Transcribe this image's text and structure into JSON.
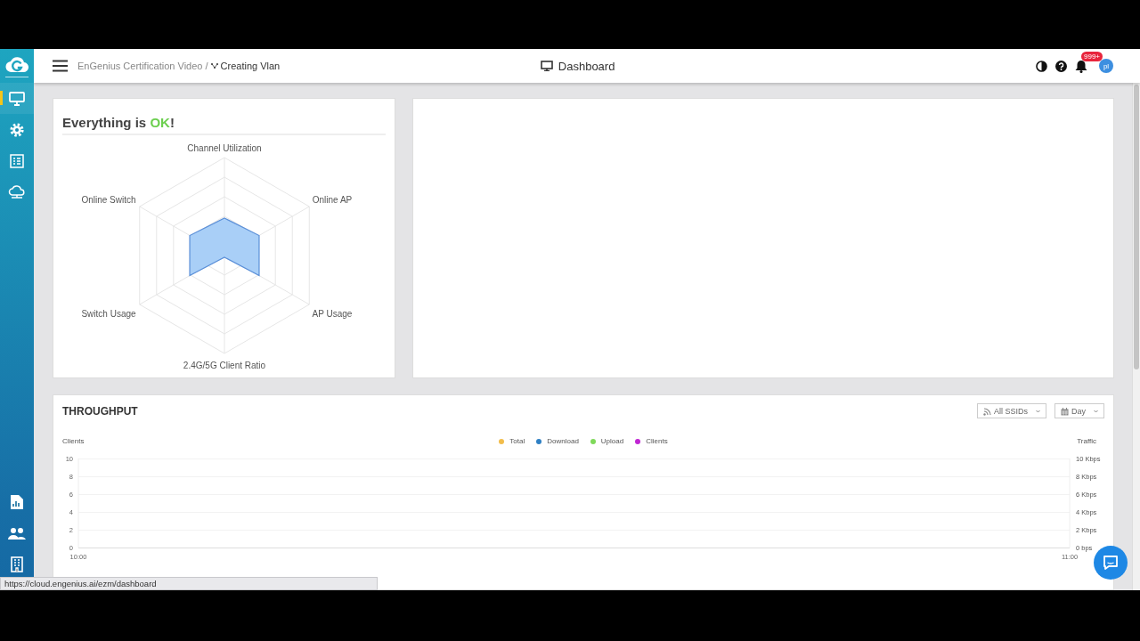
{
  "sidebar": {
    "top_items": [
      {
        "selected": true
      },
      {
        "selected": false
      },
      {
        "selected": false
      },
      {
        "selected": false
      }
    ],
    "bottom_items": [
      {
        "selected": false
      },
      {
        "selected": false
      },
      {
        "selected": false
      }
    ]
  },
  "breadcrumb": {
    "parent": "EnGenius Certification Video /",
    "current": "Creating Vlan"
  },
  "page_title": "Dashboard",
  "header": {
    "notification_badge": "999+",
    "avatar": "pl"
  },
  "health": {
    "before": "Everything is ",
    "status": "OK",
    "after": "!",
    "axes": [
      "Channel Utilization",
      "Online AP",
      "AP Usage",
      "2.4G/5G Client Ratio",
      "Switch Usage",
      "Online Switch"
    ]
  },
  "throughput": {
    "title": "THROUGHPUT",
    "filters": [
      {
        "label": "All SSIDs"
      },
      {
        "label": "Day"
      }
    ],
    "chart_data": {
      "type": "line",
      "ylabel": "Clients",
      "categories": [
        "10:00",
        "11:00"
      ],
      "ylim": [
        0,
        10
      ],
      "yticks": [
        0,
        2,
        4,
        6,
        8,
        10
      ],
      "y2label": "Traffic",
      "y2lim": [
        0,
        10
      ],
      "y2ticks": [
        {
          "value": 0,
          "label": "0 bps"
        },
        {
          "value": 2,
          "label": "2 Kbps"
        },
        {
          "value": 4,
          "label": "4 Kbps"
        },
        {
          "value": 6,
          "label": "6 Kbps"
        },
        {
          "value": 8,
          "label": "8 Kbps"
        },
        {
          "value": 10,
          "label": "10 Kbps"
        }
      ],
      "series": [
        {
          "name": "Total",
          "color": "#f2bd4b",
          "values": [
            null,
            null
          ]
        },
        {
          "name": "Download",
          "color": "#2f80c4",
          "values": [
            null,
            null
          ]
        },
        {
          "name": "Upload",
          "color": "#7fd95a",
          "values": [
            null,
            null
          ]
        },
        {
          "name": "Clients",
          "color": "#c026d3",
          "values": [
            null,
            null
          ]
        }
      ]
    }
  },
  "status_url": "https://cloud.engenius.ai/ezm/dashboard"
}
